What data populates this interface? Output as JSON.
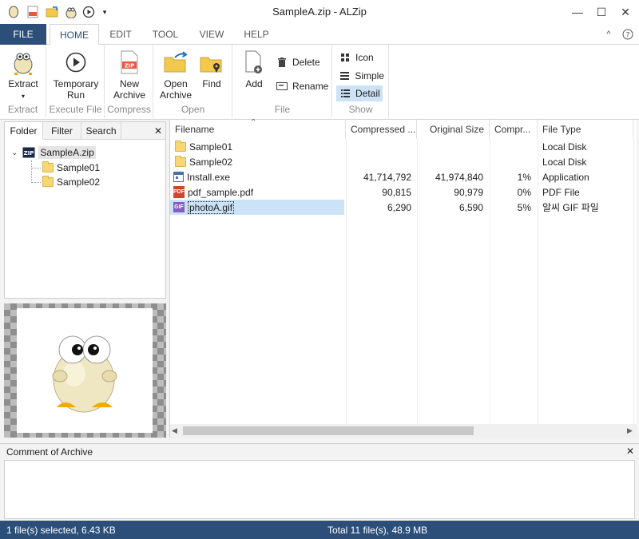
{
  "window": {
    "title": "SampleA.zip - ALZip"
  },
  "titlebar_icons": [
    "app-egg-icon",
    "zip-icon",
    "open-folder-icon",
    "egg-mascot-icon",
    "play-circle-icon",
    "dropdown-arrow-icon"
  ],
  "window_controls": {
    "minimize": "—",
    "maximize": "☐",
    "close": "✕"
  },
  "tabs": [
    {
      "label": "FILE"
    },
    {
      "label": "HOME"
    },
    {
      "label": "EDIT"
    },
    {
      "label": "TOOL"
    },
    {
      "label": "VIEW"
    },
    {
      "label": "HELP"
    }
  ],
  "ribbon": {
    "extract": {
      "label": "Extract",
      "group": "Extract"
    },
    "temporary_run": {
      "label": "Temporary\nRun",
      "group": "Execute File"
    },
    "new_archive": {
      "label": "New\nArchive",
      "group": "Compress"
    },
    "open_archive": {
      "label": "Open\nArchive"
    },
    "find": {
      "label": "Find"
    },
    "open_group": "Open",
    "add": {
      "label": "Add"
    },
    "delete": {
      "label": "Delete"
    },
    "rename": {
      "label": "Rename"
    },
    "file_group": "File",
    "icon": {
      "label": "Icon"
    },
    "simple": {
      "label": "Simple"
    },
    "detail": {
      "label": "Detail"
    },
    "show_group": "Show"
  },
  "left_panel": {
    "tabs": [
      "Folder",
      "Filter",
      "Search"
    ],
    "close": "✕",
    "tree": {
      "root": "SampleA.zip",
      "children": [
        "Sample01",
        "Sample02"
      ]
    }
  },
  "file_list": {
    "columns": [
      "Filename",
      "Compressed ...",
      "Original Size",
      "Compr...",
      "File Type"
    ],
    "rows": [
      {
        "name": "Sample01",
        "compressed": "",
        "original": "",
        "ratio": "",
        "type": "Local Disk",
        "icon": "folder-icon"
      },
      {
        "name": "Sample02",
        "compressed": "",
        "original": "",
        "ratio": "",
        "type": "Local Disk",
        "icon": "folder-icon"
      },
      {
        "name": "Install.exe",
        "compressed": "41,714,792",
        "original": "41,974,840",
        "ratio": "1%",
        "type": "Application",
        "icon": "exe-icon"
      },
      {
        "name": "pdf_sample.pdf",
        "compressed": "90,815",
        "original": "90,979",
        "ratio": "0%",
        "type": "PDF File",
        "icon": "pdf-icon"
      },
      {
        "name": "photoA.gif",
        "compressed": "6,290",
        "original": "6,590",
        "ratio": "5%",
        "type": "알씨 GIF 파일",
        "icon": "gif-icon",
        "selected": true
      }
    ]
  },
  "comment": {
    "title": "Comment of Archive",
    "close": "✕",
    "text": ""
  },
  "status": {
    "selected": "1 file(s) selected, 6.43 KB",
    "total": "Total 11 file(s), 48.9 MB"
  },
  "colors": {
    "accent": "#2b4f78",
    "selection": "#cce2f7",
    "folder": "#f7d774"
  }
}
